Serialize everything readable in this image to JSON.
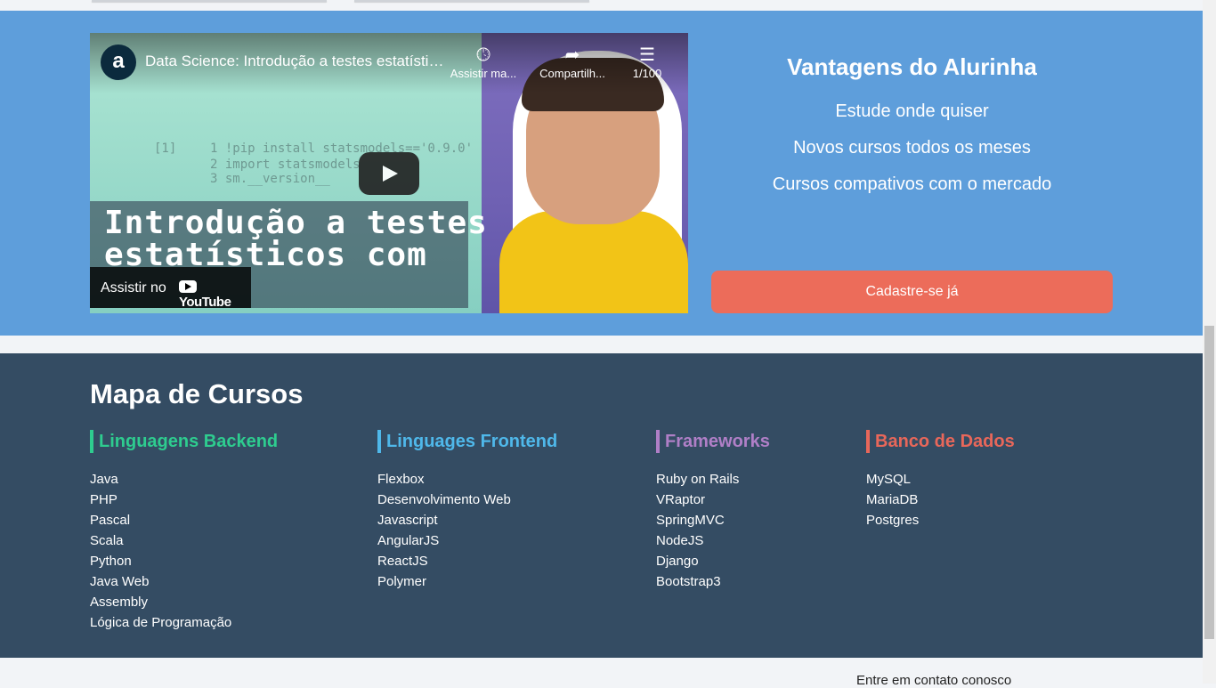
{
  "video": {
    "channel_logo": "a",
    "title": "Data Science: Introdução a testes estatísticos com Python",
    "watch_later": "Assistir ma...",
    "share": "Compartilh...",
    "playlist_count": "1/100",
    "overlay_title_line1": "Introdução a testes",
    "overlay_title_line2": "estatísticos com",
    "watch_on": "Assistir no",
    "youtube_brand": "YouTube",
    "code_lines": [
      "[1]",
      "1 !pip install statsmodels=='0.9.0'",
      "2 import statsmodels",
      "3 sm.__version__"
    ]
  },
  "advantages": {
    "title": "Vantagens do Alurinha",
    "items": [
      "Estude onde quiser",
      "Novos cursos todos os meses",
      "Cursos compativos com o mercado"
    ],
    "cta": "Cadastre-se já"
  },
  "footer": {
    "title": "Mapa de Cursos",
    "columns": [
      {
        "title": "Linguagens Backend",
        "color": "#2ecc8f",
        "items": [
          "Java",
          "PHP",
          "Pascal",
          "Scala",
          "Python",
          "Java Web",
          "Assembly",
          "Lógica de Programação"
        ]
      },
      {
        "title": "Linguages Frontend",
        "color": "#4fb8ea",
        "items": [
          "Flexbox",
          "Desenvolvimento Web",
          "Javascript",
          "AngularJS",
          "ReactJS",
          "Polymer"
        ]
      },
      {
        "title": "Frameworks",
        "color": "#b07fc7",
        "items": [
          "Ruby on Rails",
          "VRaptor",
          "SpringMVC",
          "NodeJS",
          "Django",
          "Bootstrap3"
        ]
      },
      {
        "title": "Banco de Dados",
        "color": "#e8675a",
        "items": [
          "MySQL",
          "MariaDB",
          "Postgres"
        ]
      }
    ]
  },
  "contact": "Entre em contato conosco",
  "colors": {
    "section_blue": "#5e9edb",
    "footer_bg": "#344c63",
    "cta": "#ec6c5a"
  }
}
